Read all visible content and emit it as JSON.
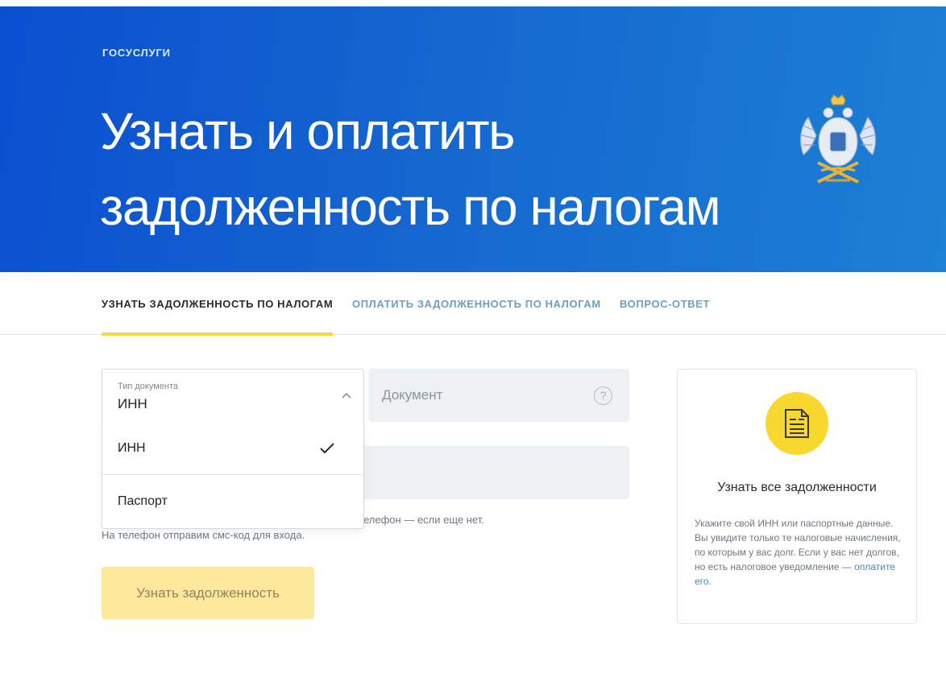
{
  "hero": {
    "label": "ГОСУСЛУГИ",
    "title_line1": "Узнать и оплатить",
    "title_line2": "задолженность по налогам",
    "emblem_icon": "double-headed-eagle-emblem"
  },
  "tabs": [
    {
      "label": "УЗНАТЬ ЗАДОЛЖЕННОСТЬ ПО НАЛОГАМ",
      "active": true
    },
    {
      "label": "ОПЛАТИТЬ ЗАДОЛЖЕННОСТЬ ПО НАЛОГАМ",
      "active": false
    },
    {
      "label": "ВОПРОС-ОТВЕТ",
      "active": false
    }
  ],
  "form": {
    "doc_type": {
      "label": "Тип документа",
      "value": "ИНН",
      "options": [
        {
          "label": "ИНН",
          "selected": true
        },
        {
          "label": "Паспорт",
          "selected": false
        }
      ]
    },
    "document": {
      "placeholder": "Документ",
      "help_symbol": "?"
    },
    "phone": {
      "value": ""
    },
    "hint_line1": "елефон — если еще нет.",
    "hint_line2": "На телефон отправим смс-код для входа.",
    "submit_label": "Узнать задолженность"
  },
  "card": {
    "title": "Узнать все задолженности",
    "text": "Укажите свой ИНН или паспортные данные. Вы увидите только те налоговые начисления, по которым у вас долг. Если у вас нет долгов, но есть налоговое уведомление —",
    "link": "оплатите его."
  },
  "colors": {
    "hero_start": "#0a4fd0",
    "hero_end": "#1c80d4",
    "accent_yellow": "#f7d73b",
    "link": "#3b8cc4"
  }
}
